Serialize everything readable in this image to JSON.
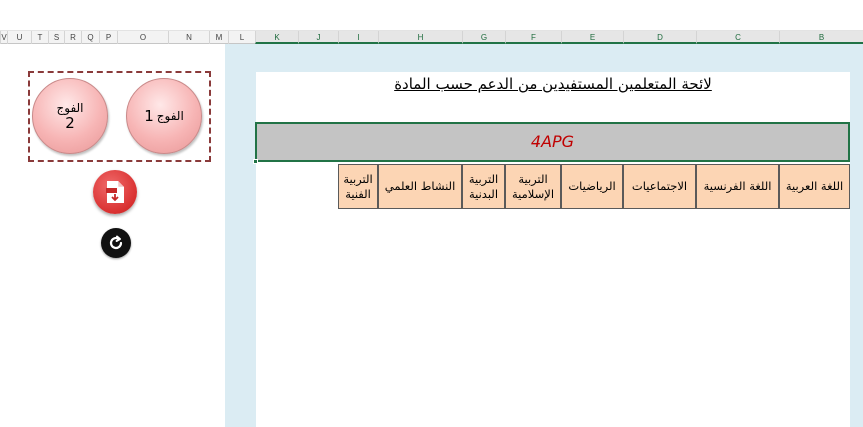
{
  "column_headers": [
    "V",
    "U",
    "T",
    "S",
    "R",
    "Q",
    "P",
    "O",
    "N",
    "M",
    "L",
    "K",
    "J",
    "I",
    "H",
    "G",
    "F",
    "E",
    "D",
    "C",
    "B"
  ],
  "sheet": {
    "title": "لائحة المتعلمين المستفيدين من الدعم حسب المادة",
    "class_name": "4APG",
    "subjects": [
      "اللغة العربية",
      "اللغة الفرنسية",
      "الاجتماعيات",
      "الرياضيات",
      "التربية الإسلامية",
      "التربية البدنية",
      "النشاط العلمي",
      "التربية الفنية"
    ],
    "subject_fill": "#fcd5b4"
  },
  "controls": {
    "group1": {
      "word": "الفوج",
      "number": "1"
    },
    "group2": {
      "word": "الفوج",
      "number": "2"
    },
    "pdf_icon": "pdf-export-icon",
    "refresh_icon": "refresh-icon"
  },
  "colors": {
    "accent_green": "#217346",
    "class_label": "#c00000",
    "page_background": "#dbecf3"
  }
}
